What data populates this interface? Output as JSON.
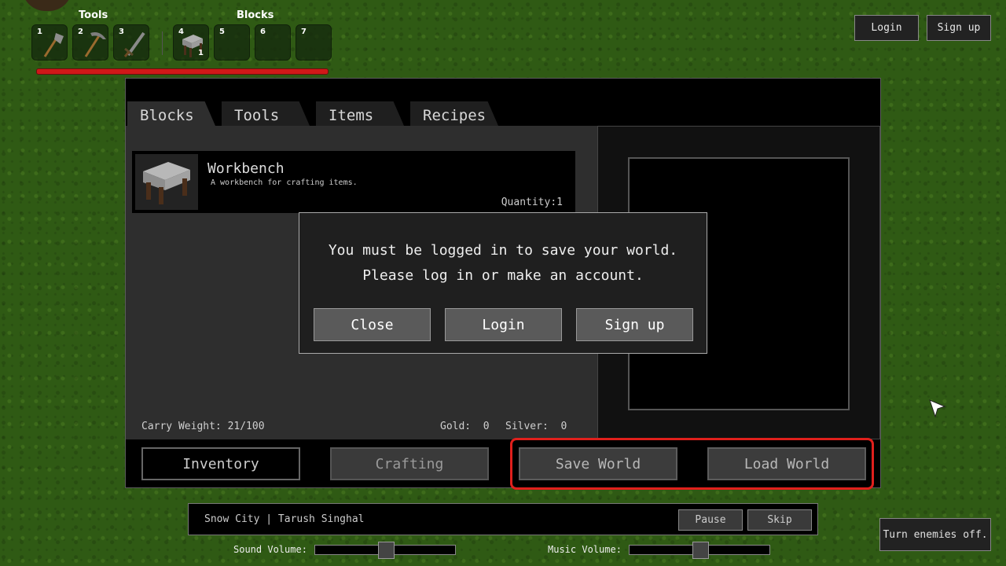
{
  "hotbar": {
    "tools_label": "Tools",
    "blocks_label": "Blocks",
    "slots": [
      {
        "num": "1",
        "icon": "axe-icon",
        "qty": ""
      },
      {
        "num": "2",
        "icon": "pickaxe-icon",
        "qty": ""
      },
      {
        "num": "3",
        "icon": "sword-icon",
        "qty": ""
      },
      {
        "num": "4",
        "icon": "workbench-icon",
        "qty": "1"
      },
      {
        "num": "5",
        "icon": "",
        "qty": ""
      },
      {
        "num": "6",
        "icon": "",
        "qty": ""
      },
      {
        "num": "7",
        "icon": "",
        "qty": ""
      }
    ],
    "health_fraction": 1.0,
    "health_color": "#d01818"
  },
  "account": {
    "login_label": "Login",
    "signup_label": "Sign up"
  },
  "inventory": {
    "tabs": [
      "Blocks",
      "Tools",
      "Items",
      "Recipes"
    ],
    "active_tab": "Blocks",
    "items": [
      {
        "name": "Workbench",
        "description": "A workbench for crafting items.",
        "quantity_label": "Quantity:",
        "quantity": "1",
        "icon": "workbench-icon"
      }
    ],
    "carry_weight": "Carry Weight: 21/100",
    "gold_label": "Gold:",
    "gold_value": "0",
    "silver_label": "Silver:",
    "silver_value": "0"
  },
  "bottom_buttons": {
    "inventory": "Inventory",
    "crafting": "Crafting",
    "save_world": "Save World",
    "load_world": "Load World"
  },
  "dialog": {
    "line1": "You must be logged in to save your world.",
    "line2": "Please log in or make an account.",
    "close": "Close",
    "login": "Login",
    "signup": "Sign up"
  },
  "music": {
    "track": "Snow City | Tarush Singhal",
    "pause": "Pause",
    "skip": "Skip"
  },
  "volume": {
    "sound_label": "Sound Volume:",
    "sound_level": 0.5,
    "music_label": "Music Volume:",
    "music_level": 0.5
  },
  "enemies_toggle": "Turn enemies off.",
  "colors": {
    "highlight": "#e0201c",
    "grass": "#2f5a14"
  }
}
